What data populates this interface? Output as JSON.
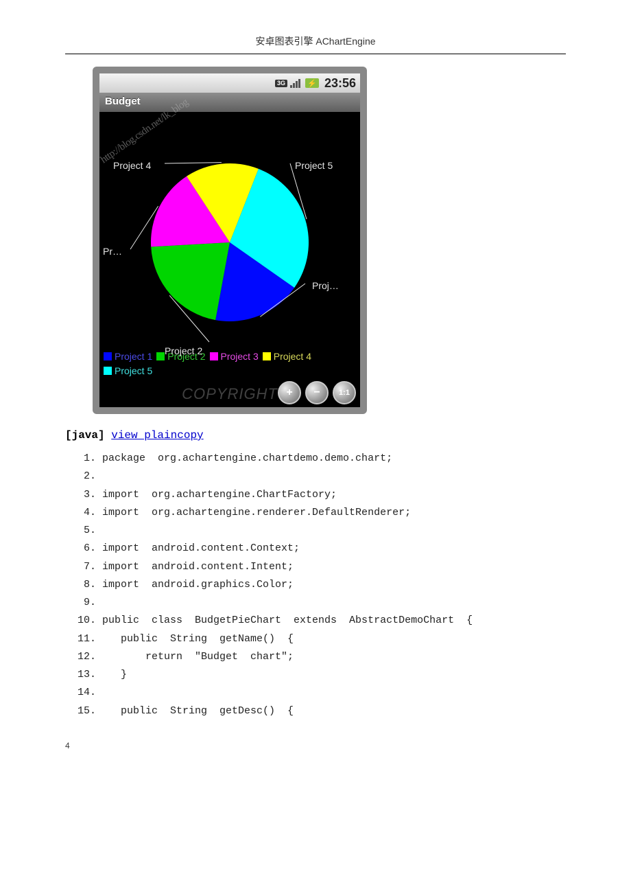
{
  "doc": {
    "header": "安卓图表引擎 AChartEngine",
    "page_number": "4"
  },
  "statusbar": {
    "net": "3G",
    "battery": "⚡",
    "time": "23:56"
  },
  "app": {
    "title": "Budget"
  },
  "chart_data": {
    "type": "pie",
    "title": "Budget",
    "series": [
      {
        "name": "Project 1",
        "value": 12,
        "color": "#0008FF",
        "label": "Proj…",
        "legend_color": "#4b4be6"
      },
      {
        "name": "Project 2",
        "value": 14,
        "color": "#00D500",
        "label": "Project 2",
        "legend_color": "#34c934"
      },
      {
        "name": "Project 3",
        "value": 11,
        "color": "#FF00FF",
        "label": "Pr…",
        "legend_color": "#e64be6"
      },
      {
        "name": "Project 4",
        "value": 10,
        "color": "#FFFF00",
        "label": "Project 4",
        "legend_color": "#d8d85a"
      },
      {
        "name": "Project 5",
        "value": 19,
        "color": "#00FFFF",
        "label": "Project 5",
        "legend_color": "#40e0e0"
      }
    ]
  },
  "zoom": {
    "in": "+",
    "out": "−",
    "fit": "1:1"
  },
  "watermarks": {
    "url": "http://blog.csdn.net/lk_blog",
    "copyright": "COPYRIGHT"
  },
  "code_block": {
    "lang_label": "[java]",
    "link1": "view plain",
    "link2": "copy",
    "lines": [
      "package  org.achartengine.chartdemo.demo.chart;",
      "",
      "import  org.achartengine.ChartFactory;",
      "import  org.achartengine.renderer.DefaultRenderer;",
      "",
      "import  android.content.Context;",
      "import  android.content.Intent;",
      "import  android.graphics.Color;",
      "",
      "public  class  BudgetPieChart  extends  AbstractDemoChart  {",
      "   public  String  getName()  {",
      "       return  \"Budget  chart\";",
      "   }",
      "",
      "   public  String  getDesc()  {"
    ]
  }
}
